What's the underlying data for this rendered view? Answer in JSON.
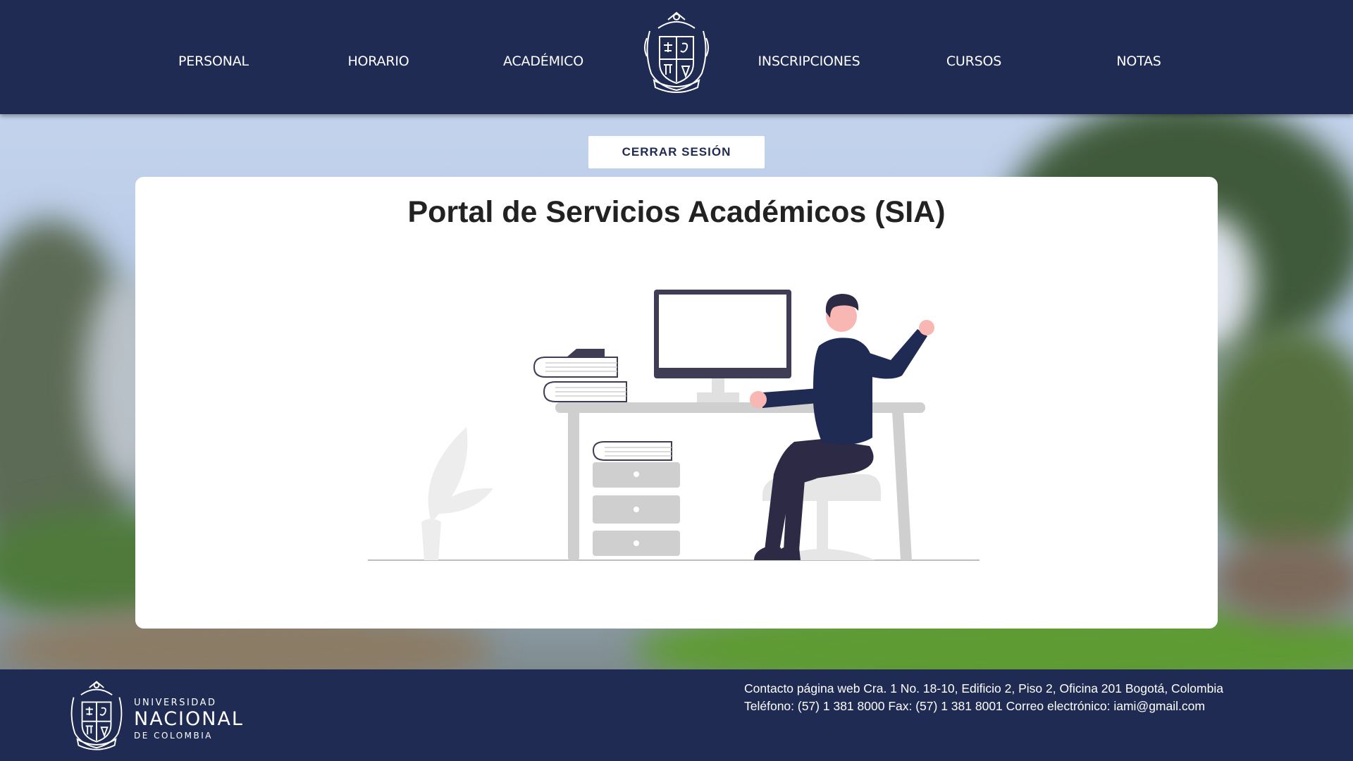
{
  "nav": {
    "items": [
      {
        "label": "PERSONAL"
      },
      {
        "label": "HORARIO"
      },
      {
        "label": "ACADÉMICO"
      },
      {
        "label": "INSCRIPCIONES"
      },
      {
        "label": "CURSOS"
      },
      {
        "label": "NOTAS"
      }
    ],
    "logo_icon": "university-crest-icon"
  },
  "actions": {
    "logout_label": "CERRAR SESIÓN"
  },
  "main": {
    "title": "Portal de Servicios Académicos (SIA)",
    "illustration": "person-at-desk-illustration"
  },
  "footer": {
    "brand": {
      "line1": "UNIVERSIDAD",
      "line2": "NACIONAL",
      "line3": "DE COLOMBIA"
    },
    "contact_line1": "Contacto página web Cra. 1 No. 18-10, Edificio 2, Piso 2, Oficina 201 Bogotá, Colombia",
    "contact_line2": "Teléfono: (57) 1 381 8000 Fax: (57) 1 381 8001 Correo electrónico: iami@gmail.com"
  },
  "colors": {
    "navy": "#1f2b52",
    "white": "#ffffff",
    "illustration_gray": "#cfcfcf",
    "skin": "#f8b7b3",
    "shirt": "#1f2b52",
    "pants": "#2c2a44"
  }
}
